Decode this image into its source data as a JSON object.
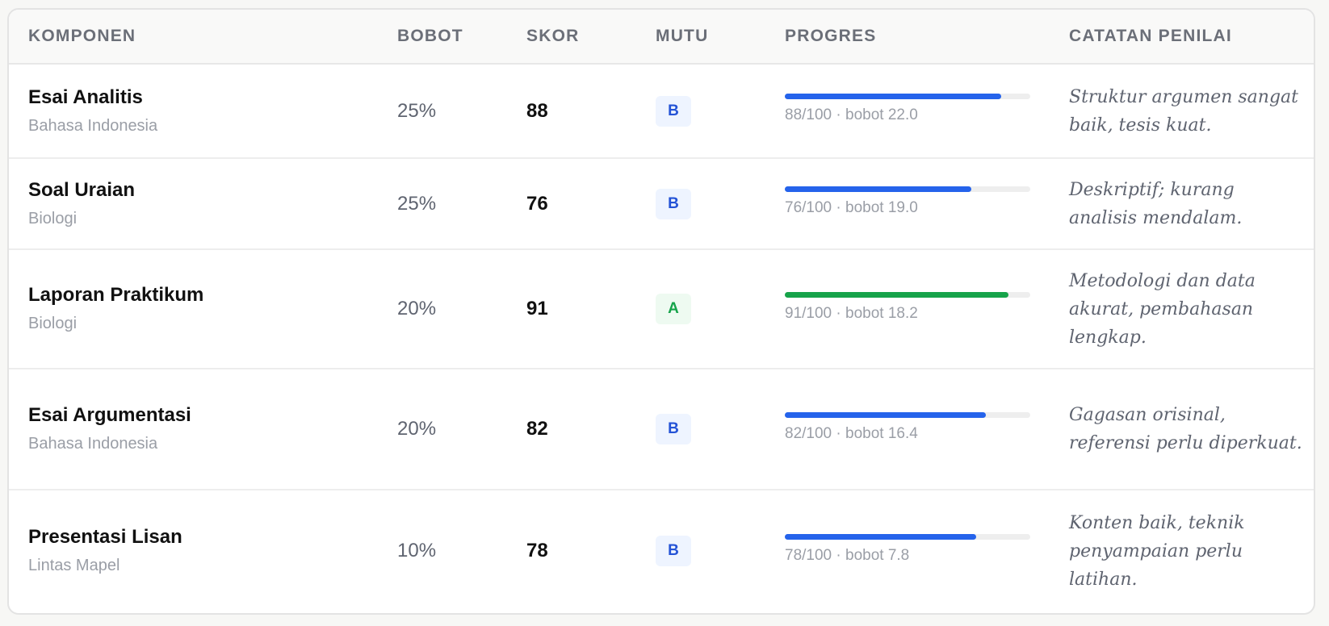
{
  "table": {
    "headers": {
      "komponen": "KOMPONEN",
      "bobot": "BOBOT",
      "skor": "SKOR",
      "mutu": "MUTU",
      "progres": "PROGRES",
      "catatan": "CATATAN PENILAI"
    },
    "rows": [
      {
        "name": "Esai Analitis",
        "subject": "Bahasa Indonesia",
        "weight": "25%",
        "score": "88",
        "grade": "B",
        "progress": 0.88,
        "progress_text": "88/100 · bobot 22.0",
        "note": "Struktur argumen sangat baik, tesis kuat."
      },
      {
        "name": "Soal Uraian",
        "subject": "Biologi",
        "weight": "25%",
        "score": "76",
        "grade": "B",
        "progress": 0.76,
        "progress_text": "76/100 · bobot 19.0",
        "note": "Deskriptif; kurang analisis mendalam."
      },
      {
        "name": "Laporan Praktikum",
        "subject": "Biologi",
        "weight": "20%",
        "score": "91",
        "grade": "A",
        "progress": 0.91,
        "progress_text": "91/100 · bobot 18.2",
        "note": "Metodologi dan data akurat, pembahasan lengkap."
      },
      {
        "name": "Esai Argumentasi",
        "subject": "Bahasa Indonesia",
        "weight": "20%",
        "score": "82",
        "grade": "B",
        "progress": 0.82,
        "progress_text": "82/100 · bobot 16.4",
        "note": "Gagasan orisinal, referensi perlu diperkuat."
      },
      {
        "name": "Presentasi Lisan",
        "subject": "Lintas Mapel",
        "weight": "10%",
        "score": "78",
        "grade": "B",
        "progress": 0.78,
        "progress_text": "78/100 · bobot 7.8",
        "note": "Konten baik, teknik penyampaian perlu latihan."
      }
    ]
  },
  "colors": {
    "grade_b": "#2453d6",
    "grade_a": "#16a34a",
    "bar_default": "#2563eb",
    "bar_top": "#16a34a"
  }
}
